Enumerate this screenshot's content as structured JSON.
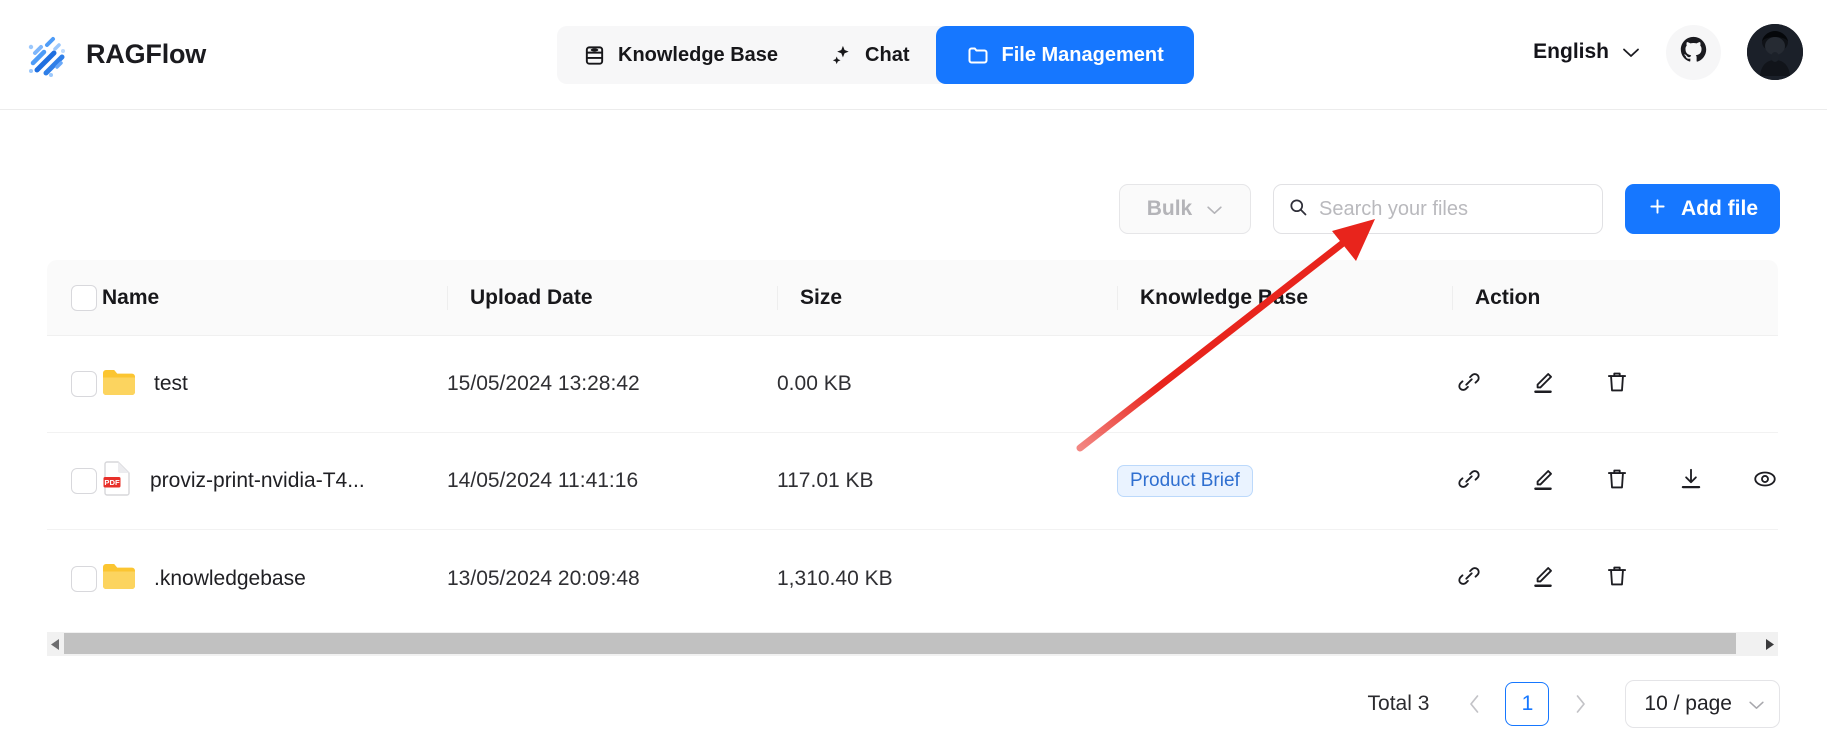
{
  "brand": {
    "name": "RAGFlow",
    "logo_icon": "ragflow-logo-icon"
  },
  "nav": {
    "items": [
      {
        "label": "Knowledge Base",
        "icon": "database-icon",
        "active": false
      },
      {
        "label": "Chat",
        "icon": "sparkle-icon",
        "active": false
      },
      {
        "label": "File Management",
        "icon": "folder-icon",
        "active": true
      }
    ]
  },
  "header_right": {
    "language": "English",
    "language_caret_icon": "chevron-down-icon",
    "github_icon": "github-icon",
    "avatar_icon": "user-avatar"
  },
  "toolbar": {
    "bulk_label": "Bulk",
    "bulk_caret_icon": "chevron-down-icon",
    "search_icon": "search-icon",
    "search_value": "",
    "search_placeholder": "Search your files",
    "add_file_label": "Add file",
    "add_file_icon": "plus-icon"
  },
  "table": {
    "columns": [
      "Name",
      "Upload Date",
      "Size",
      "Knowledge Base",
      "Action"
    ],
    "select_all_checked": false,
    "rows": [
      {
        "name": "test",
        "file_icon": "folder-icon",
        "upload_date": "15/05/2024 13:28:42",
        "size": "0.00 KB",
        "knowledge_base": "",
        "checked": false,
        "actions": [
          "link-icon",
          "edit-icon",
          "trash-icon"
        ]
      },
      {
        "name": "proviz-print-nvidia-T4...",
        "file_icon": "pdf-icon",
        "upload_date": "14/05/2024 11:41:16",
        "size": "117.01 KB",
        "knowledge_base": "Product Brief",
        "checked": false,
        "actions": [
          "link-icon",
          "edit-icon",
          "trash-icon",
          "download-icon",
          "eye-icon"
        ]
      },
      {
        "name": ".knowledgebase",
        "file_icon": "folder-icon",
        "upload_date": "13/05/2024 20:09:48",
        "size": "1,310.40 KB",
        "knowledge_base": "",
        "checked": false,
        "actions": [
          "link-icon",
          "edit-icon",
          "trash-icon"
        ]
      }
    ]
  },
  "scrollbar": {
    "left_arrow_icon": "triangle-left-icon",
    "right_arrow_icon": "triangle-right-icon"
  },
  "pagination": {
    "total_label": "Total 3",
    "prev_icon": "chevron-left-icon",
    "next_icon": "chevron-right-icon",
    "current_page": "1",
    "page_size_label": "10 / page",
    "page_size_caret_icon": "chevron-down-icon"
  },
  "annotation": {
    "arrow_color": "#e8241c",
    "arrow_icon": "red-pointer-arrow"
  },
  "colors": {
    "accent": "#1677ff",
    "tag_text": "#2f6fd0",
    "tag_bg": "#eaf3ff",
    "annotation_red": "#e8241c",
    "folder_yellow": "#fbc531",
    "pdf_red": "#e8302a"
  }
}
